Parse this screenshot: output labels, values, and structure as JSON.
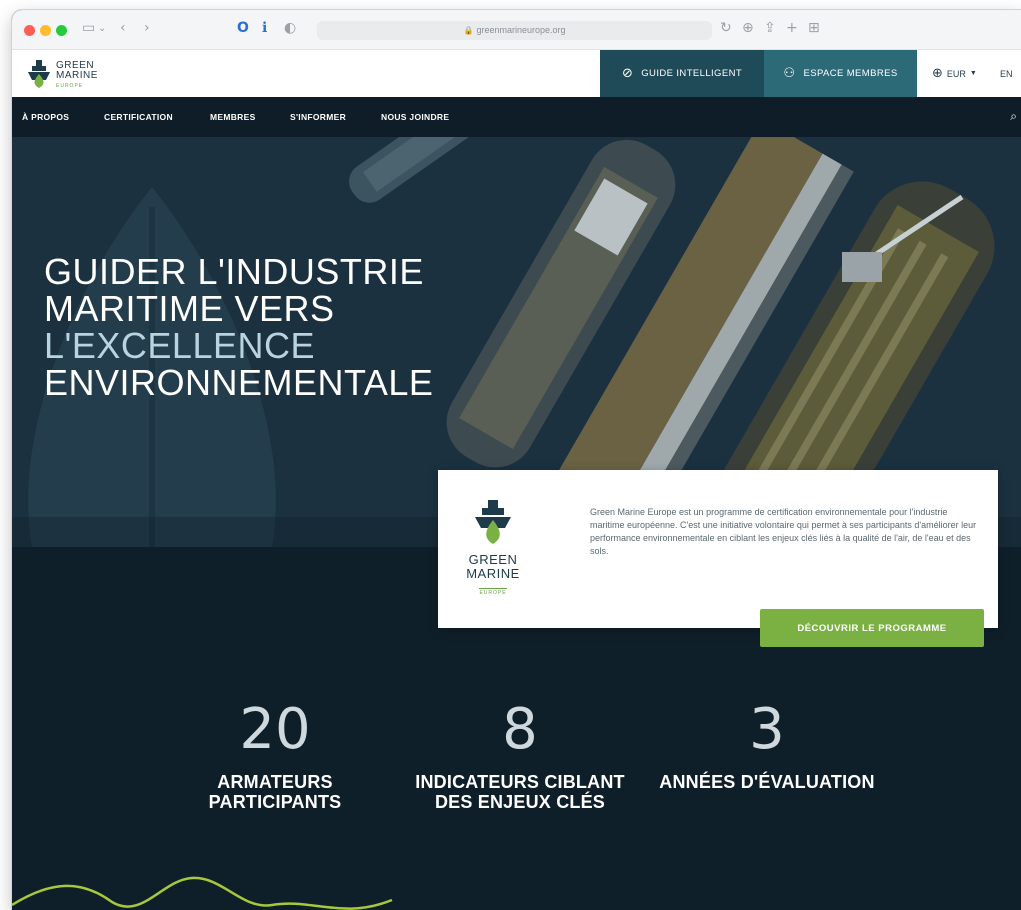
{
  "browser": {
    "url": "greenmarineurope.org"
  },
  "header": {
    "logo_line1": "GREEN",
    "logo_line2": "MARINE",
    "logo_sub": "EUROPE",
    "cta_guide": "GUIDE INTELLIGENT",
    "cta_membres": "ESPACE MEMBRES",
    "currency": "EUR",
    "language": "EN"
  },
  "nav": {
    "items": [
      "À PROPOS",
      "CERTIFICATION",
      "MEMBRES",
      "S'INFORMER",
      "NOUS JOINDRE"
    ]
  },
  "hero": {
    "line1": "GUIDER L'INDUSTRIE",
    "line2": "MARITIME VERS",
    "line3": "L'EXCELLENCE",
    "line4": "ENVIRONNEMENTALE"
  },
  "card": {
    "logo_line1": "GREEN",
    "logo_line2": "MARINE",
    "logo_sub": "EUROPE",
    "text": "Green Marine Europe est un programme de certification environnementale pour l'industrie maritime européenne. C'est une initiative volontaire qui permet à ses participants d'améliorer leur performance environnementale en ciblant les enjeux clés liés à la qualité de l'air, de l'eau et des sols.",
    "button": "DÉCOUVRIR LE PROGRAMME"
  },
  "stats": [
    {
      "number": "20",
      "label_line1": "ARMATEURS",
      "label_line2": "PARTICIPANTS"
    },
    {
      "number": "8",
      "label_line1": "INDICATEURS CIBLANT",
      "label_line2": "DES ENJEUX CLÉS"
    },
    {
      "number": "3",
      "label_line1": "ANNÉES D'ÉVALUATION",
      "label_line2": ""
    }
  ],
  "colors": {
    "brand_dark": "#0e1d27",
    "brand_teal": "#1f4b58",
    "brand_teal_light": "#2c6a77",
    "accent_green": "#7ab142",
    "wave_green": "#a6c83a"
  }
}
